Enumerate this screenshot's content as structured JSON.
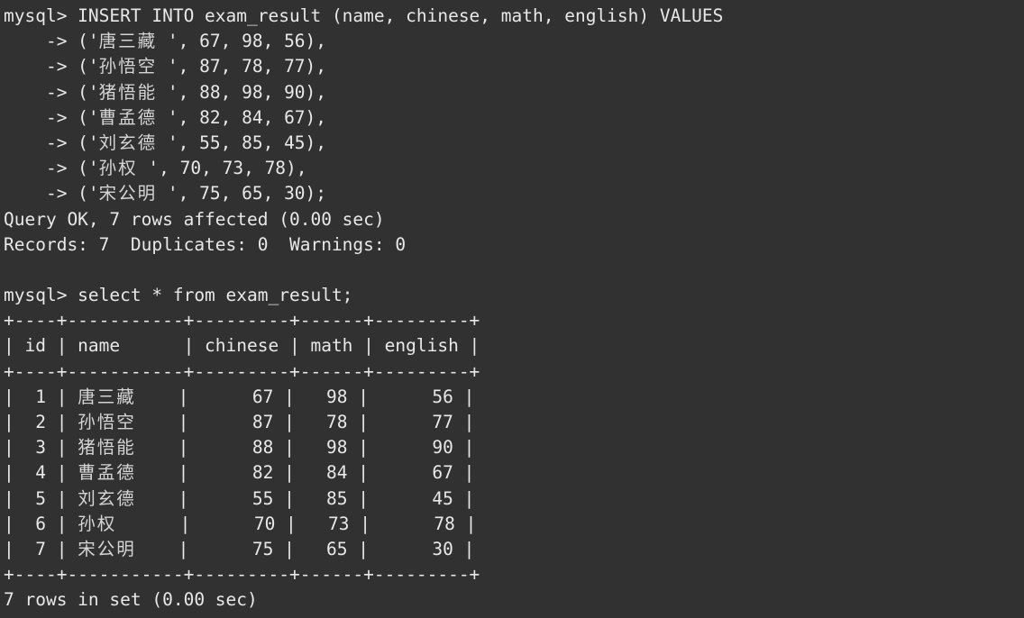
{
  "terminal": {
    "background_color": "#313131",
    "foreground_color": "#e8e8e8",
    "prompt": "mysql> ",
    "continuation_prompt": "    -> "
  },
  "lines": [
    {
      "name": "insert-command-line",
      "text": "mysql> INSERT INTO exam_result (name, chinese, math, english) VALUES"
    },
    {
      "name": "insert-values-row-1",
      "text": "    -> ('唐三藏 ', 67, 98, 56),"
    },
    {
      "name": "insert-values-row-2",
      "text": "    -> ('孙悟空 ', 87, 78, 77),"
    },
    {
      "name": "insert-values-row-3",
      "text": "    -> ('猪悟能 ', 88, 98, 90),"
    },
    {
      "name": "insert-values-row-4",
      "text": "    -> ('曹孟德 ', 82, 84, 67),"
    },
    {
      "name": "insert-values-row-5",
      "text": "    -> ('刘玄德 ', 55, 85, 45),"
    },
    {
      "name": "insert-values-row-6",
      "text": "    -> ('孙权 ', 70, 73, 78),"
    },
    {
      "name": "insert-values-row-7",
      "text": "    -> ('宋公明 ', 75, 65, 30);"
    },
    {
      "name": "query-ok-line",
      "text": "Query OK, 7 rows affected (0.00 sec)"
    },
    {
      "name": "records-line",
      "text": "Records: 7  Duplicates: 0  Warnings: 0"
    },
    {
      "name": "blank-line",
      "text": ""
    },
    {
      "name": "select-command-line",
      "text": "mysql> select * from exam_result;"
    },
    {
      "name": "table-top-border",
      "text": "+----+-----------+---------+------+---------+"
    },
    {
      "name": "table-header-row",
      "text": "| id | name      | chinese | math | english |"
    },
    {
      "name": "table-header-border",
      "text": "+----+-----------+---------+------+---------+"
    },
    {
      "name": "table-data-row-1",
      "text": "|  1 | 唐三藏    |      67 |   98 |      56 |"
    },
    {
      "name": "table-data-row-2",
      "text": "|  2 | 孙悟空    |      87 |   78 |      77 |"
    },
    {
      "name": "table-data-row-3",
      "text": "|  3 | 猪悟能    |      88 |   98 |      90 |"
    },
    {
      "name": "table-data-row-4",
      "text": "|  4 | 曹孟德    |      82 |   84 |      67 |"
    },
    {
      "name": "table-data-row-5",
      "text": "|  5 | 刘玄德    |      55 |   85 |      45 |"
    },
    {
      "name": "table-data-row-6",
      "text": "|  6 | 孙权      |      70 |   73 |      78 |"
    },
    {
      "name": "table-data-row-7",
      "text": "|  7 | 宋公明    |      75 |   65 |      30 |"
    },
    {
      "name": "table-bottom-border",
      "text": "+----+-----------+---------+------+---------+"
    },
    {
      "name": "rows-in-set-line",
      "text": "7 rows in set (0.00 sec)"
    }
  ],
  "result_table": {
    "columns": [
      "id",
      "name",
      "chinese",
      "math",
      "english"
    ],
    "rows": [
      {
        "id": "1",
        "name": "唐三藏",
        "chinese": "67",
        "math": "98",
        "english": "56"
      },
      {
        "id": "2",
        "name": "孙悟空",
        "chinese": "87",
        "math": "78",
        "english": "77"
      },
      {
        "id": "3",
        "name": "猪悟能",
        "chinese": "88",
        "math": "98",
        "english": "90"
      },
      {
        "id": "4",
        "name": "曹孟德",
        "chinese": "82",
        "math": "84",
        "english": "67"
      },
      {
        "id": "5",
        "name": "刘玄德",
        "chinese": "55",
        "math": "85",
        "english": "45"
      },
      {
        "id": "6",
        "name": "孙权",
        "chinese": "70",
        "math": "73",
        "english": "78"
      },
      {
        "id": "7",
        "name": "宋公明",
        "chinese": "75",
        "math": "65",
        "english": "30"
      }
    ],
    "row_count_status": "7 rows in set (0.00 sec)"
  },
  "insert_result": {
    "status": "Query OK, 7 rows affected (0.00 sec)",
    "records": "Records: 7  Duplicates: 0  Warnings: 0"
  }
}
